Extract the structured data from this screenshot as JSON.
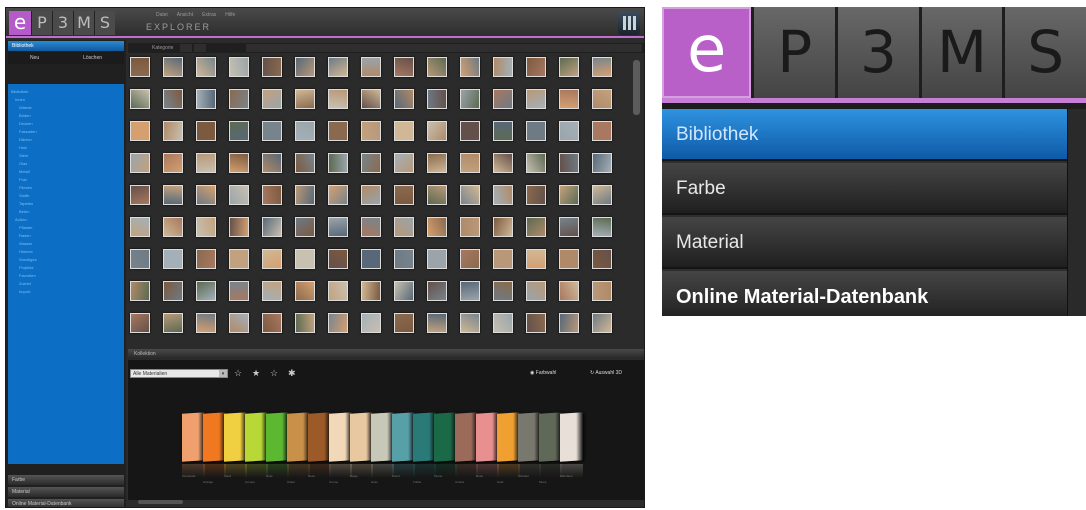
{
  "logo": {
    "e": "e",
    "letters": [
      "P",
      "3",
      "M",
      "S"
    ]
  },
  "app": {
    "title": "EXPLORER",
    "menu": [
      "Datei",
      "Ansicht",
      "Extras",
      "Hilfe"
    ],
    "sidebar": {
      "tab_library": "Bibliothek",
      "tools": [
        "Neu",
        "Löschen"
      ],
      "tree": [
        "Bibliothek",
        "Innen",
        "Wände",
        "Böden",
        "Decken",
        "Fassaden",
        "Dächer",
        "Holz",
        "Stein",
        "Glas",
        "Metall",
        "Putz",
        "Fliesen",
        "Stoffe",
        "Tapeten",
        "Beton",
        "Außen",
        "Pflaster",
        "Rasen",
        "Wasser",
        "Himmel",
        "Sonstiges",
        "Projekte",
        "Favoriten",
        "Zuletzt",
        "Import"
      ],
      "bottom": [
        "Farbe",
        "Material",
        "Online Material-Datenbank"
      ]
    },
    "grid_bar": {
      "label": "Kategorie"
    },
    "collection": {
      "header": "Kollektion",
      "select_value": "Alle Materialien",
      "btn_color": "Farbwahl",
      "btn_3d": "Auswahl 3D",
      "swatch_colors": [
        "#f0a06e",
        "#f07820",
        "#f0d040",
        "#b8d838",
        "#5cb830",
        "#c89048",
        "#9c5a28",
        "#f0d8b8",
        "#e8c8a0",
        "#c8c8b8",
        "#58a0a8",
        "#2a7a78",
        "#1a6a48",
        "#9c6a58",
        "#e89090",
        "#f0a030",
        "#78786e",
        "#606858",
        "#e8e0d8"
      ],
      "swatch_labels": [
        "Terracotta",
        "Orange",
        "Sand",
        "Limone",
        "Gras",
        "Ocker",
        "Nuss",
        "Creme",
        "Beige",
        "Grau",
        "Petrol",
        "Türkis",
        "Tanne",
        "Umbra",
        "Rosé",
        "Gold",
        "Schiefer",
        "Moos",
        "Elfenbein"
      ]
    }
  },
  "inset": {
    "nav": [
      "Bibliothek",
      "Farbe",
      "Material",
      "Online Material-Datenbank"
    ]
  },
  "thumb_palette": [
    "#8a6a4e",
    "#b08a68",
    "#6e7a84",
    "#c2a27e",
    "#7c5a40",
    "#9aa4aa",
    "#d0b896",
    "#5c6a52",
    "#a87860",
    "#c8c0b0",
    "#78848c",
    "#b89878",
    "#64504a",
    "#a4b0b8",
    "#d4a070",
    "#586878"
  ]
}
